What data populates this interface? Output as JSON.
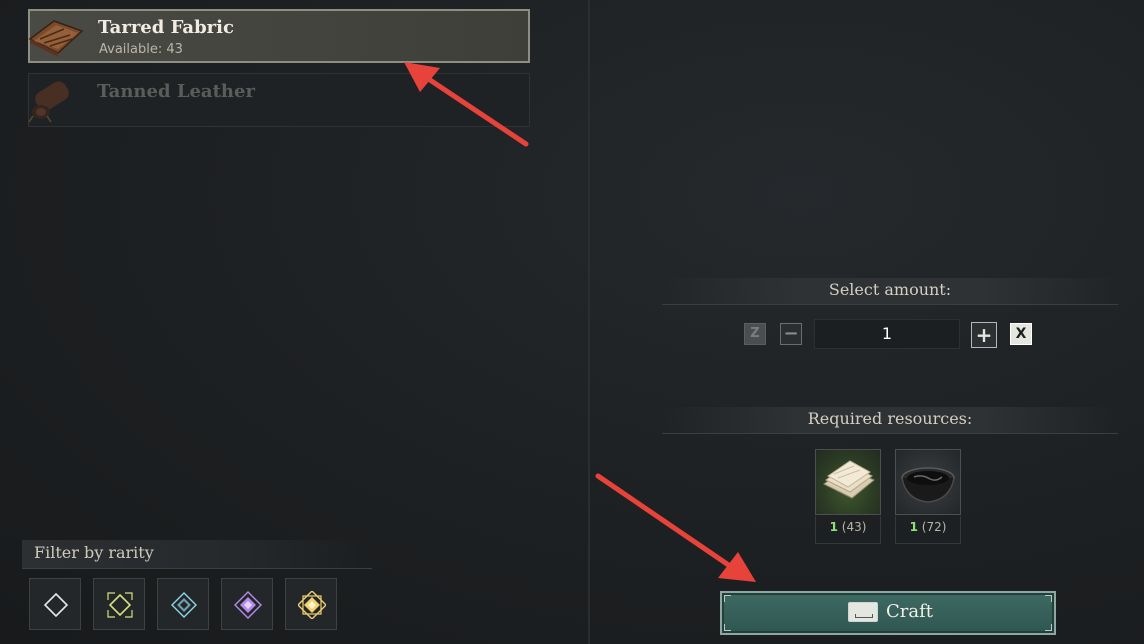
{
  "recipes": [
    {
      "name": "Tarred Fabric",
      "available": "Available: 43",
      "state": "selected",
      "icon": "tarred-fabric-icon"
    },
    {
      "name": "Tanned Leather",
      "state": "disabled",
      "icon": "tanned-leather-icon"
    }
  ],
  "filter": {
    "title": "Filter by rarity",
    "rarities": [
      {
        "name": "common",
        "color": "#e8e8e8"
      },
      {
        "name": "uncommon",
        "color": "#d8e07a"
      },
      {
        "name": "rare",
        "color": "#8fd6e6"
      },
      {
        "name": "epic",
        "color": "#b48ce8"
      },
      {
        "name": "legendary",
        "color": "#f0d070"
      }
    ]
  },
  "amount": {
    "title": "Select amount:",
    "min_key": "Z",
    "decrease_glyph": "−",
    "value": "1",
    "increase_glyph": "+",
    "max_key": "X"
  },
  "resources": {
    "title": "Required resources:",
    "items": [
      {
        "icon": "cloth-icon",
        "need": "1",
        "have": "(43)"
      },
      {
        "icon": "tar-bowl-icon",
        "need": "1",
        "have": "(72)"
      }
    ]
  },
  "craft": {
    "label": "Craft",
    "key_icon": "spacebar-key-icon"
  },
  "annotations": {
    "arrow_color": "#e8433a"
  }
}
